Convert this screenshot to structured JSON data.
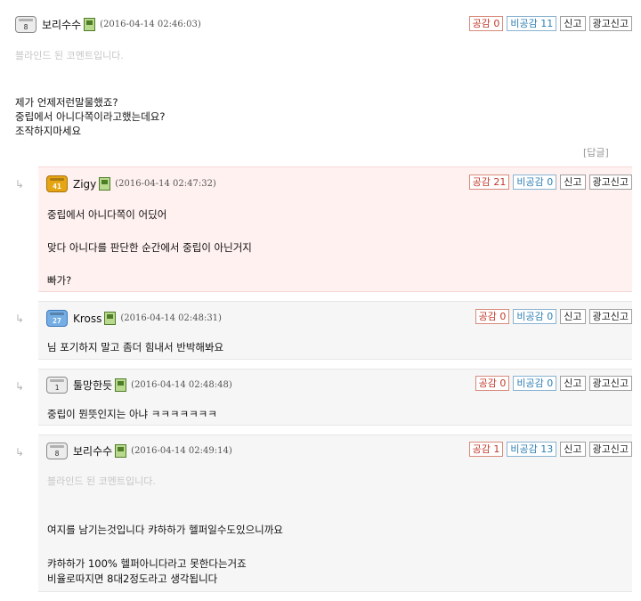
{
  "buttons": {
    "agree": "공감",
    "disagree": "비공감",
    "report": "신고",
    "ad_report": "광고신고"
  },
  "icons": {
    "level": "level-badge-icon",
    "mobile": "mobile-phone-icon",
    "reply_arrow": "reply-arrow-icon"
  },
  "colors": {
    "agree": "#c0392b",
    "disagree": "#2f7fb4",
    "best_reply_bg": "#fff1f0",
    "reply_bg": "#f6f6f6",
    "blind_text": "#c6c6c6"
  },
  "reply_link": "[답글]",
  "comments": [
    {
      "level": "8",
      "nickname": "보리수수",
      "date": "(2016-04-14 02:46:03)",
      "agree": "공감 0",
      "disagree": "비공감 11",
      "blind": "블라인드 된 코멘트입니다.",
      "lines": [
        "제가 언제저런말물했죠?",
        "중립에서 아니다쪽이라고했는데요?",
        "조작하지마세요"
      ]
    },
    {
      "level": "41",
      "nickname": "Zigy",
      "date": "(2016-04-14 02:47:32)",
      "agree": "공감 21",
      "disagree": "비공감 0",
      "lines": [
        "중립에서 아니다쪽이 어딨어",
        "맞다 아니다를 판단한 순간에서 중립이 아닌거지",
        "빠가?"
      ]
    },
    {
      "level": "27",
      "nickname": "Kross",
      "date": "(2016-04-14 02:48:31)",
      "agree": "공감 0",
      "disagree": "비공감 0",
      "lines": [
        "님 포기하지 말고 좀더 힘내서 반박해봐요"
      ]
    },
    {
      "level": "1",
      "nickname": "툴망한듯",
      "date": "(2016-04-14 02:48:48)",
      "agree": "공감 0",
      "disagree": "비공감 0",
      "lines": [
        "중립이 뭔뜻인지는 아냐 ㅋㅋㅋㅋㅋㅋㅋ"
      ]
    },
    {
      "level": "8",
      "nickname": "보리수수",
      "date": "(2016-04-14 02:49:14)",
      "agree": "공감 1",
      "disagree": "비공감 13",
      "blind": "블라인드 된 코멘트입니다.",
      "lines": [
        "여지를 남기는것입니다 캬하하가 헬퍼일수도있으니까요",
        "캬하하가 100% 헬퍼아니다라고 못한다는거죠",
        "비율로따지면 8대2정도라고 생각됩니다"
      ]
    }
  ]
}
